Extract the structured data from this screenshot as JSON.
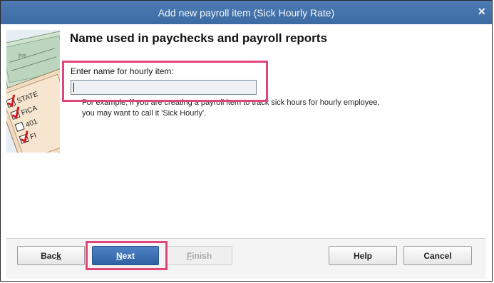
{
  "window": {
    "title": "Add new payroll item (Sick Hourly Rate)",
    "close_glyph": "×"
  },
  "illustration": {
    "icon": "paycheck-checklist-illustration",
    "checklist": [
      "STATE",
      "FICA",
      "401",
      "FI"
    ],
    "check_label": "Pay"
  },
  "main": {
    "heading": "Name used in paychecks and payroll reports",
    "field_label": "Enter name for hourly item:",
    "name_value": "",
    "hint": "For example, if you are creating a payroll item to track sick hours for hourly employee, you may want to call it 'Sick Hourly'."
  },
  "buttons": {
    "back": {
      "pre": "Bac",
      "accel": "k",
      "post": ""
    },
    "next": {
      "pre": "",
      "accel": "N",
      "post": "ext"
    },
    "finish": {
      "pre": "",
      "accel": "F",
      "post": "inish"
    },
    "help": "Help",
    "cancel": "Cancel"
  },
  "colors": {
    "titlebar": "#4471a9",
    "highlight": "#e0457b",
    "primary_button": "#3a6fb3"
  }
}
